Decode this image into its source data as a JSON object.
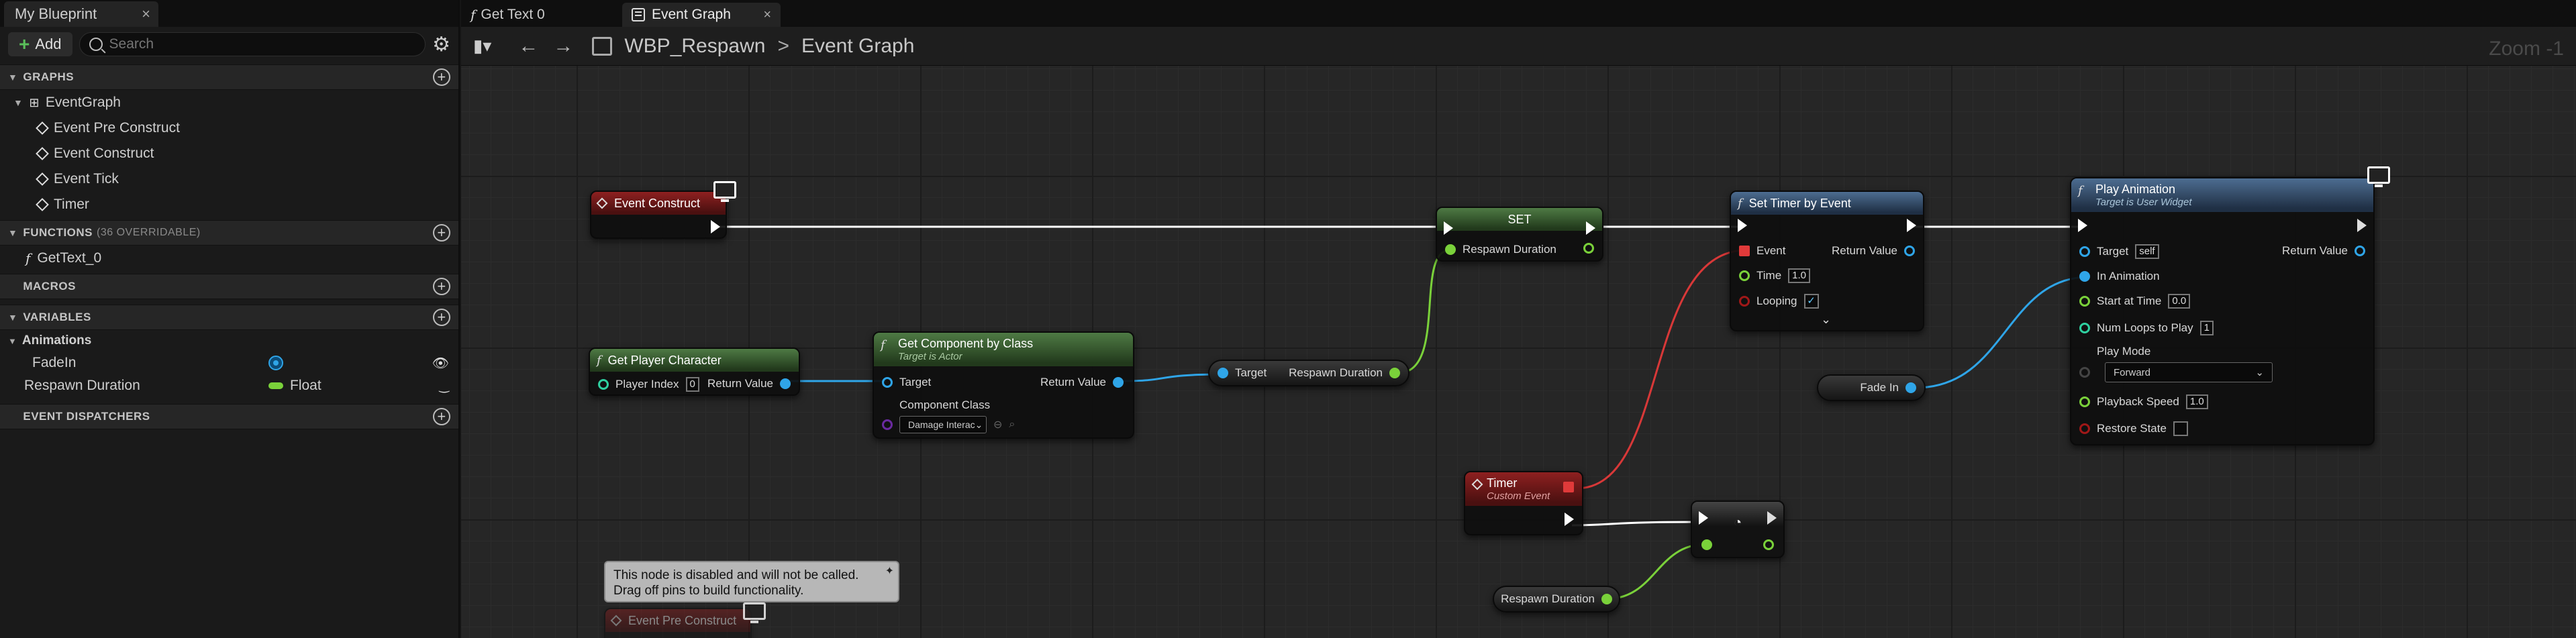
{
  "left_panel": {
    "tab_title": "My Blueprint",
    "add_label": "Add",
    "search_placeholder": "Search",
    "sections": {
      "graphs": "GRAPHS",
      "functions": "FUNCTIONS",
      "functions_note": "(36 OVERRIDABLE)",
      "macros": "MACROS",
      "variables": "VARIABLES",
      "event_dispatchers": "EVENT DISPATCHERS"
    },
    "graphs": {
      "root": "EventGraph",
      "items": [
        "Event Pre Construct",
        "Event Construct",
        "Event Tick",
        "Timer"
      ]
    },
    "functions": [
      "GetText_0"
    ],
    "variables": {
      "category": "Animations",
      "items": [
        {
          "name": "FadeIn",
          "type": ""
        },
        {
          "name": "Respawn Duration",
          "type": "Float"
        }
      ]
    }
  },
  "doc_tabs": [
    {
      "label": "Get Text 0"
    },
    {
      "label": "Event Graph"
    }
  ],
  "breadcrumb": {
    "blueprint": "WBP_Respawn",
    "graph": "Event Graph"
  },
  "zoom_label": "Zoom -1",
  "nodes": {
    "event_construct": {
      "title": "Event Construct"
    },
    "get_player_character": {
      "title": "Get Player Character",
      "player_index_label": "Player Index",
      "player_index_value": "0",
      "return_label": "Return Value"
    },
    "get_component": {
      "title": "Get Component by Class",
      "subtitle": "Target is Actor",
      "target_label": "Target",
      "return_label": "Return Value",
      "class_label": "Component Class",
      "class_value": "Damage Interac"
    },
    "respawn_get": {
      "target_label": "Target",
      "out_label": "Respawn Duration"
    },
    "set_node": {
      "title": "SET",
      "pin_label": "Respawn Duration"
    },
    "set_timer": {
      "title": "Set Timer by Event",
      "event_label": "Event",
      "return_label": "Return Value",
      "time_label": "Time",
      "time_value": "1.0",
      "looping_label": "Looping",
      "looping_value": "✓"
    },
    "play_animation": {
      "title": "Play Animation",
      "subtitle": "Target is User Widget",
      "target_label": "Target",
      "target_value": "self",
      "return_label": "Return Value",
      "in_animation_label": "In Animation",
      "start_label": "Start at Time",
      "start_value": "0.0",
      "loops_label": "Num Loops to Play",
      "loops_value": "1",
      "mode_label": "Play Mode",
      "mode_value": "Forward",
      "speed_label": "Playback Speed",
      "speed_value": "1.0",
      "restore_label": "Restore State"
    },
    "fade_in": {
      "label": "Fade In"
    },
    "timer_event": {
      "title": "Timer",
      "subtitle": "Custom Event"
    },
    "respawn_duration_var": {
      "label": "Respawn Duration"
    },
    "event_pre_construct": {
      "title": "Event Pre Construct"
    }
  },
  "comment": {
    "line1": "This node is disabled and will not be called.",
    "line2": "Drag off pins to build functionality."
  },
  "colors": {
    "event_header": "#8e2020",
    "pure_header": "#4e7a44",
    "func_header": "#4d6d91",
    "float_pin": "#7ad13a",
    "object_pin": "#2fa5e8",
    "delegate_wire": "#e03a3a"
  }
}
